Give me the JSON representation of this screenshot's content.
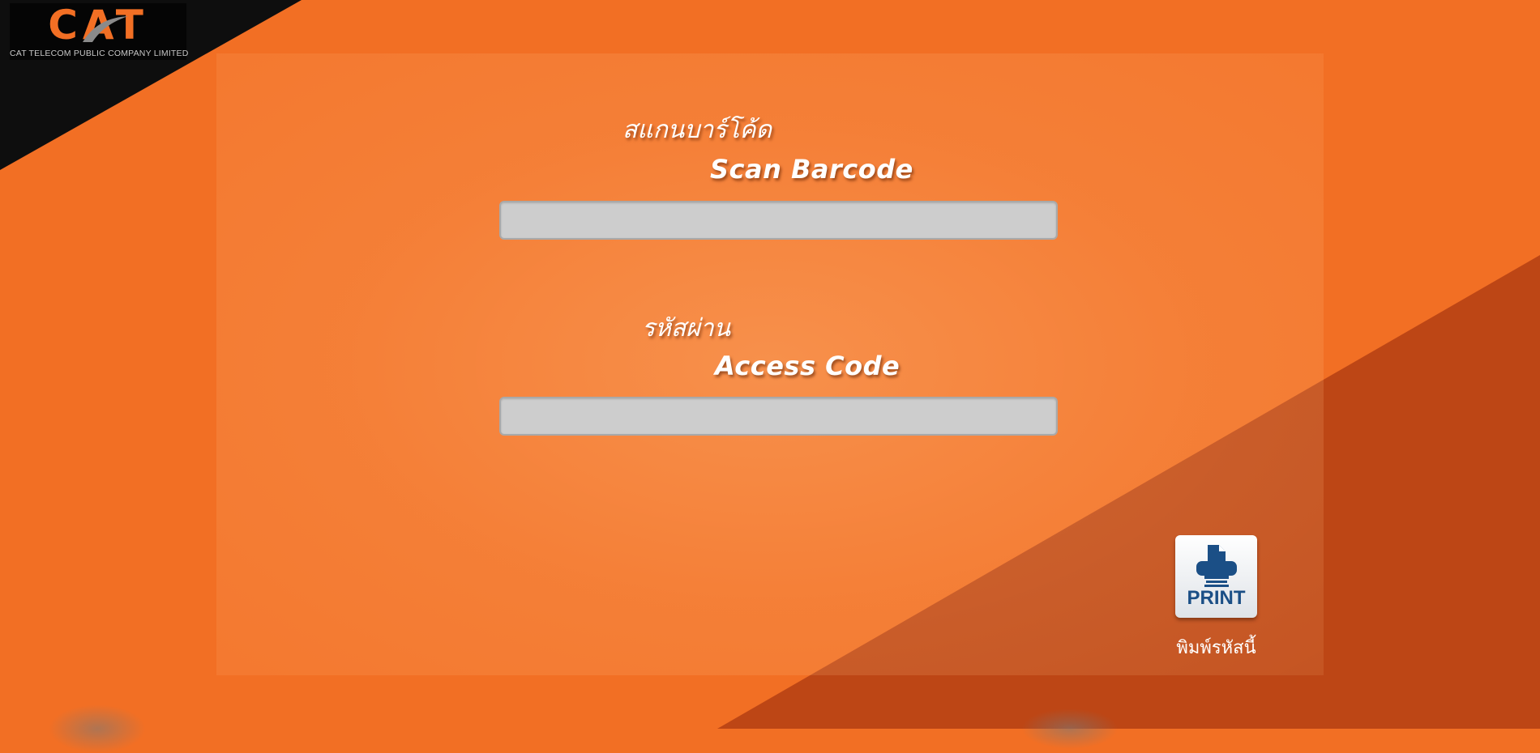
{
  "logo": {
    "mark": "CAT",
    "company": "CAT TELECOM PUBLIC COMPANY LIMITED"
  },
  "scan": {
    "label_thai": "สแกนบาร์โค้ด",
    "label_en": "Scan Barcode",
    "value": ""
  },
  "access": {
    "label_thai": "รหัสผ่าน",
    "label_en": "Access Code",
    "value": ""
  },
  "print_button": {
    "label": "PRINT",
    "caption": "พิมพ์รหัสนี้",
    "icon": "printer-icon"
  },
  "colors": {
    "background": "#f26f24",
    "corner": "#0e0e0e",
    "field": "#cdcdcd",
    "print_text": "#1b4f86"
  }
}
